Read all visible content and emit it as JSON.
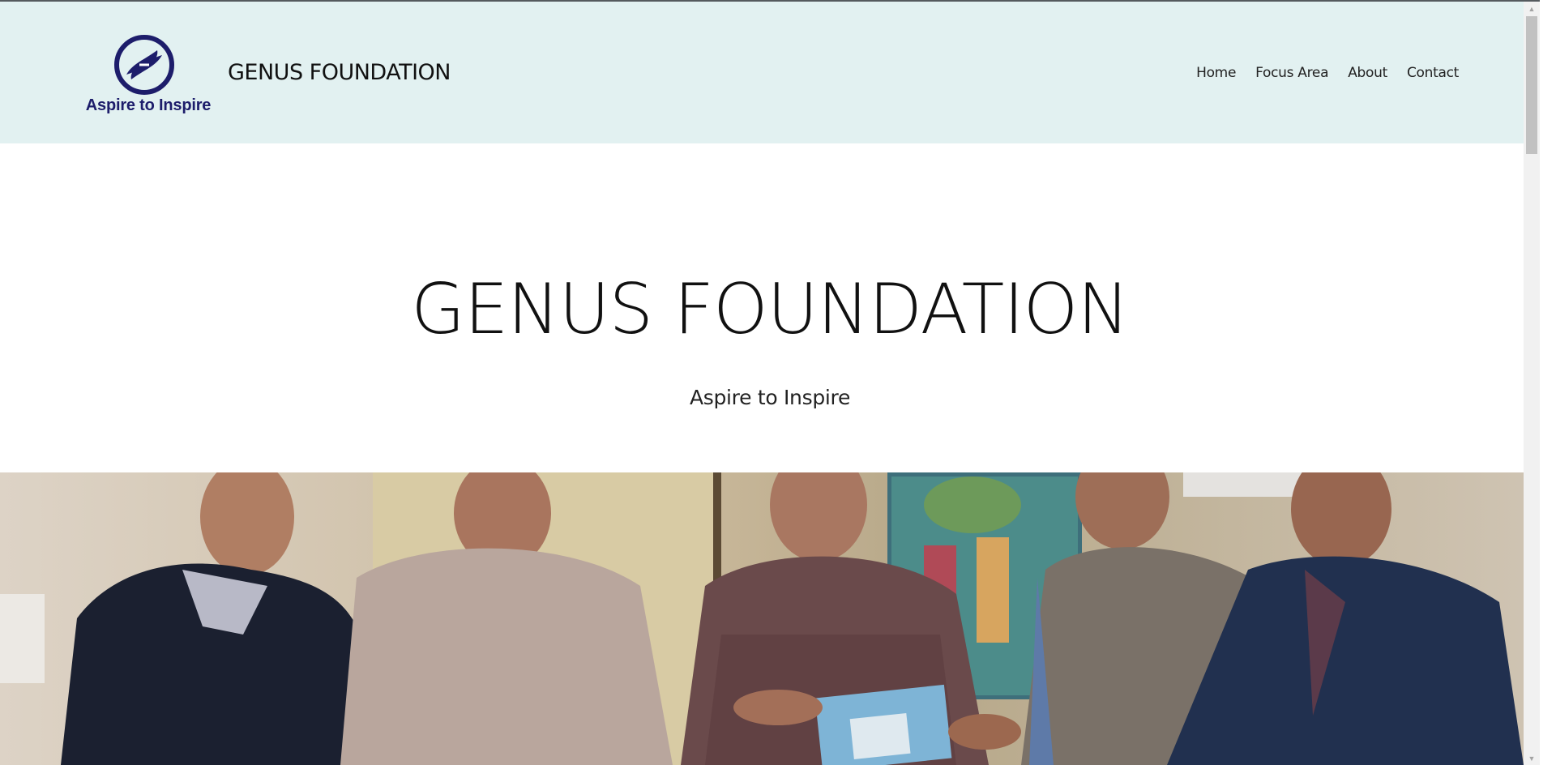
{
  "header": {
    "logo_tagline": "Aspire to Inspire",
    "site_title": "GENUS FOUNDATION",
    "nav": [
      {
        "label": "Home"
      },
      {
        "label": "Focus Area"
      },
      {
        "label": "About"
      },
      {
        "label": "Contact"
      }
    ]
  },
  "hero": {
    "title": "GENUS FOUNDATION",
    "subtitle": "Aspire to Inspire"
  },
  "colors": {
    "header_bg": "#e2f1f1",
    "logo_blue": "#1d1d6b"
  },
  "icons": {
    "logo": "hands-logo-icon",
    "scroll_up": "triangle-up-icon",
    "scroll_down": "triangle-down-icon"
  }
}
